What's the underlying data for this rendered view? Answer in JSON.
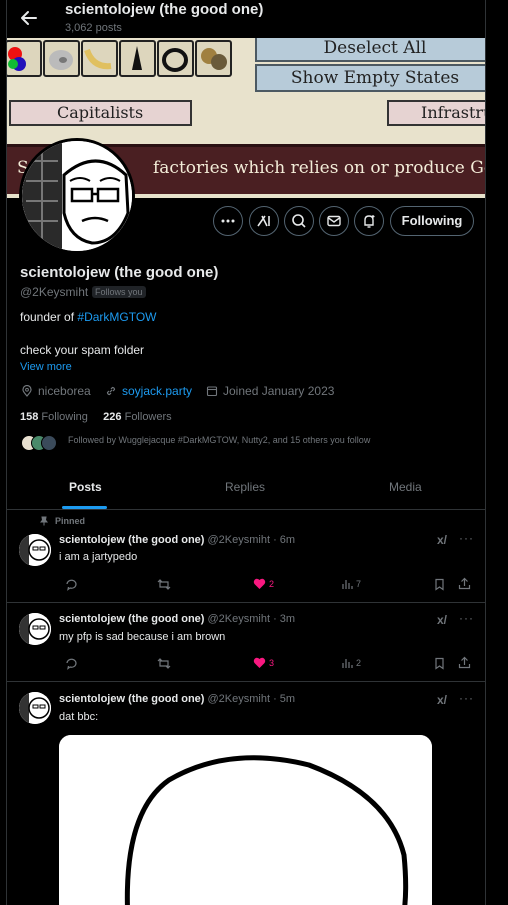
{
  "header": {
    "title": "scientolojew (the good one)",
    "post_count": "3,062 posts"
  },
  "banner": {
    "deselect_label": "Deselect All",
    "show_empty_label": "Show Empty States",
    "capitalists_label": "Capitalists",
    "infrastructure_label": "Infrastru",
    "band_prefix": "S",
    "band_text": "factories which relies on or produce Gems"
  },
  "profile": {
    "name": "scientolojew (the good one)",
    "handle": "@2Keysmiht",
    "follows_you": "Follows you",
    "bio_prefix": "founder of",
    "bio_tag": "#DarkMGTOW",
    "bio_line2": "check your spam folder",
    "view_more": "View more",
    "location": "niceborea",
    "website": "soyjack.party",
    "joined": "Joined January 2023",
    "following_count": "158",
    "following_label": "Following",
    "followers_count": "226",
    "followers_label": "Followers",
    "followed_by": "Followed by Wugglejacque #DarkMGTOW, Nutty2, and 15 others you follow",
    "follow_button": "Following"
  },
  "tabs": [
    "Posts",
    "Replies",
    "Media"
  ],
  "posts": [
    {
      "pinned_label": "Pinned",
      "author": "scientolojew (the good one)",
      "meta": "@2Keysmiht · 6m",
      "text": "i am a jartypedo",
      "likes": "2",
      "views": "7"
    },
    {
      "author": "scientolojew (the good one)",
      "meta": "@2Keysmiht · 3m",
      "text": "my pfp is sad because i am brown",
      "likes": "3",
      "views": "2"
    },
    {
      "author": "scientolojew (the good one)",
      "meta": "@2Keysmiht · 5m",
      "text": "dat bbc:"
    }
  ],
  "colors": {
    "accent": "#1d9bf0",
    "like": "#f91880",
    "muted": "#71767b",
    "banner_band": "#4a1f22"
  },
  "icons": [
    "back-arrow-icon",
    "more-icon",
    "grok-icon",
    "search-icon",
    "mail-icon",
    "notify-icon",
    "location-icon",
    "link-icon",
    "calendar-icon",
    "pin-icon",
    "reply-icon",
    "repost-icon",
    "heart-icon",
    "views-icon",
    "bookmark-icon",
    "share-icon"
  ]
}
